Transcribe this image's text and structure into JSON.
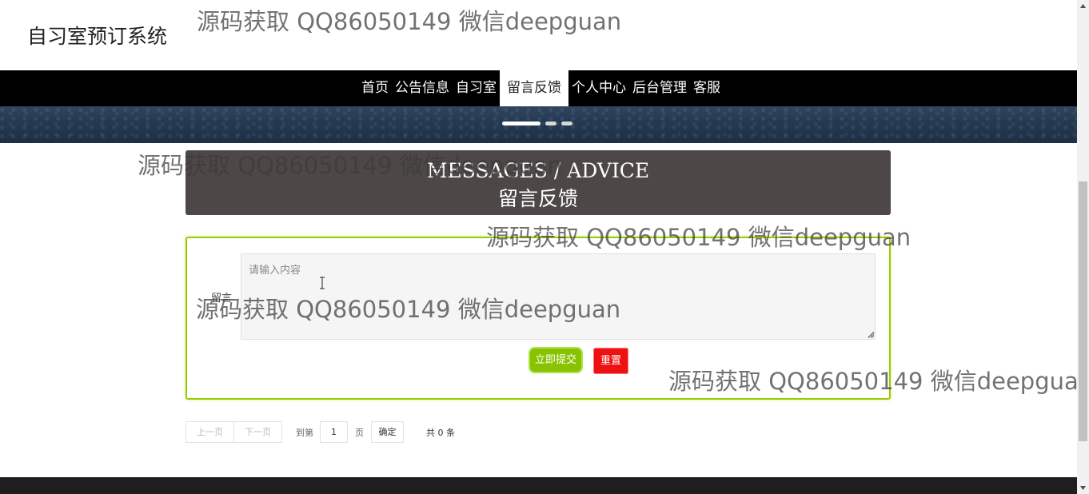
{
  "header": {
    "title": "自习室预订系统"
  },
  "nav": {
    "items": [
      {
        "label": "首页"
      },
      {
        "label": "公告信息"
      },
      {
        "label": "自习室"
      },
      {
        "label": "留言反馈",
        "active": true
      },
      {
        "label": "个人中心"
      },
      {
        "label": "后台管理"
      },
      {
        "label": "客服"
      }
    ]
  },
  "banner": {
    "slides": 3,
    "active_slide": 1
  },
  "section": {
    "title_en": "MESSAGES / ADVICE",
    "title_zh": "留言反馈"
  },
  "form": {
    "label": "留言",
    "textarea_value": "",
    "placeholder": "请输入内容",
    "submit_label": "立即提交",
    "reset_label": "重置"
  },
  "pager": {
    "prev_label": "上一页",
    "next_label": "下一页",
    "goto_label": "到第",
    "page_value": "1",
    "page_unit": "页",
    "confirm_label": "确定",
    "total_label": "共 0 条"
  },
  "watermark": {
    "text": "源码获取 QQ86050149 微信deepguan"
  },
  "colors": {
    "nav_bg": "#000000",
    "section_bg": "#4e4747",
    "form_border": "#99cc00",
    "submit_bg": "#88c200",
    "reset_bg": "#ee1111",
    "footer_bg": "#1e1e1e"
  },
  "icons": {
    "text_cursor": "text-cursor-icon",
    "resize": "resize-grip-icon",
    "scroll_up": "chevron-up-icon",
    "scroll_down": "chevron-down-icon"
  }
}
